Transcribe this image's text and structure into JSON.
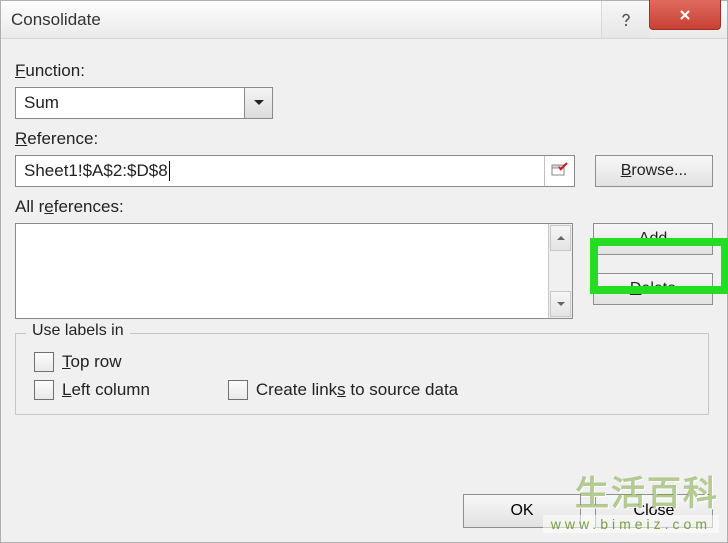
{
  "window": {
    "title": "Consolidate"
  },
  "function": {
    "label_pre": "",
    "label_ul": "F",
    "label_post": "unction:",
    "value": "Sum"
  },
  "reference": {
    "label_pre": "",
    "label_ul": "R",
    "label_post": "eference:",
    "value": "Sheet1!$A$2:$D$8"
  },
  "browse": {
    "pre": "",
    "ul": "B",
    "post": "rowse..."
  },
  "all_references": {
    "label_pre": "All r",
    "label_ul": "e",
    "label_post": "ferences:"
  },
  "add": {
    "pre": "",
    "ul": "A",
    "post": "dd"
  },
  "delete": {
    "pre": "",
    "ul": "D",
    "post": "elete"
  },
  "group": {
    "title": "Use labels in"
  },
  "top_row": {
    "pre": "",
    "ul": "T",
    "post": "op row"
  },
  "left_col": {
    "pre": "",
    "ul": "L",
    "post": "eft column"
  },
  "create_links": {
    "pre": "Create link",
    "ul": "s",
    "post": " to source data"
  },
  "footer": {
    "ok": "OK",
    "close": "Close"
  },
  "watermark": {
    "line1": "生活百科",
    "line2": "www.bimeiz.com"
  }
}
